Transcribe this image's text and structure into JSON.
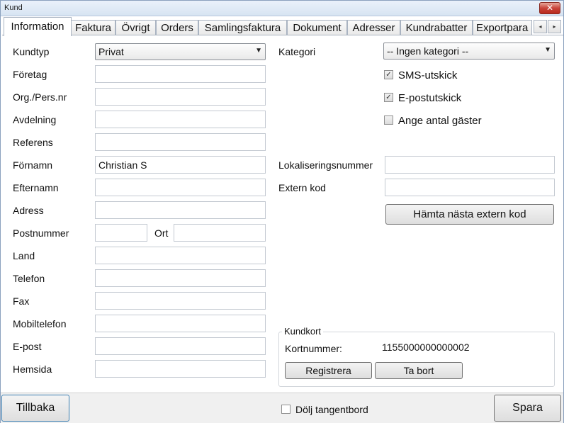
{
  "window": {
    "title": "Kund",
    "close_label": "✕"
  },
  "tabs": [
    {
      "label": "Information",
      "active": true
    },
    {
      "label": "Faktura"
    },
    {
      "label": "Övrigt"
    },
    {
      "label": "Orders"
    },
    {
      "label": "Samlingsfaktura"
    },
    {
      "label": "Dokument"
    },
    {
      "label": "Adresser"
    },
    {
      "label": "Kundrabatter"
    },
    {
      "label": "Exportpara"
    }
  ],
  "tab_scroll": {
    "left_icon": "◂",
    "right_icon": "▸"
  },
  "left_form": {
    "kundtyp": {
      "label": "Kundtyp",
      "value": "Privat"
    },
    "foretag": {
      "label": "Företag",
      "value": ""
    },
    "orgnr": {
      "label": "Org./Pers.nr",
      "value": ""
    },
    "avdelning": {
      "label": "Avdelning",
      "value": ""
    },
    "referens": {
      "label": "Referens",
      "value": ""
    },
    "fornamn": {
      "label": "Förnamn",
      "value": "Christian S"
    },
    "efternamn": {
      "label": "Efternamn",
      "value": ""
    },
    "adress": {
      "label": "Adress",
      "value": ""
    },
    "postnummer": {
      "label": "Postnummer",
      "value": ""
    },
    "ort": {
      "label": "Ort",
      "value": ""
    },
    "land": {
      "label": "Land",
      "value": ""
    },
    "telefon": {
      "label": "Telefon",
      "value": ""
    },
    "fax": {
      "label": "Fax",
      "value": ""
    },
    "mobiltelefon": {
      "label": "Mobiltelefon",
      "value": ""
    },
    "epost": {
      "label": "E-post",
      "value": ""
    },
    "hemsida": {
      "label": "Hemsida",
      "value": ""
    }
  },
  "right_form": {
    "kategori": {
      "label": "Kategori",
      "value": "-- Ingen kategori --"
    },
    "sms": {
      "label": "SMS-utskick",
      "checked": true
    },
    "epostutskick": {
      "label": "E-postutskick",
      "checked": true
    },
    "gaster": {
      "label": "Ange antal gäster",
      "checked": false
    },
    "lokalisering": {
      "label": "Lokaliseringsnummer",
      "value": ""
    },
    "externkod": {
      "label": "Extern kod",
      "value": ""
    },
    "next_code_button": "Hämta nästa extern kod"
  },
  "kundkort": {
    "title": "Kundkort",
    "card_label": "Kortnummer:",
    "card_number": "1155000000000002",
    "register_button": "Registrera",
    "remove_button": "Ta bort"
  },
  "bottom": {
    "back_button": "Tillbaka",
    "hide_keyboard": {
      "label": "Dölj tangentbord",
      "checked": false
    },
    "save_button": "Spara"
  },
  "icons": {
    "dropdown": "▼",
    "check": "✓"
  }
}
